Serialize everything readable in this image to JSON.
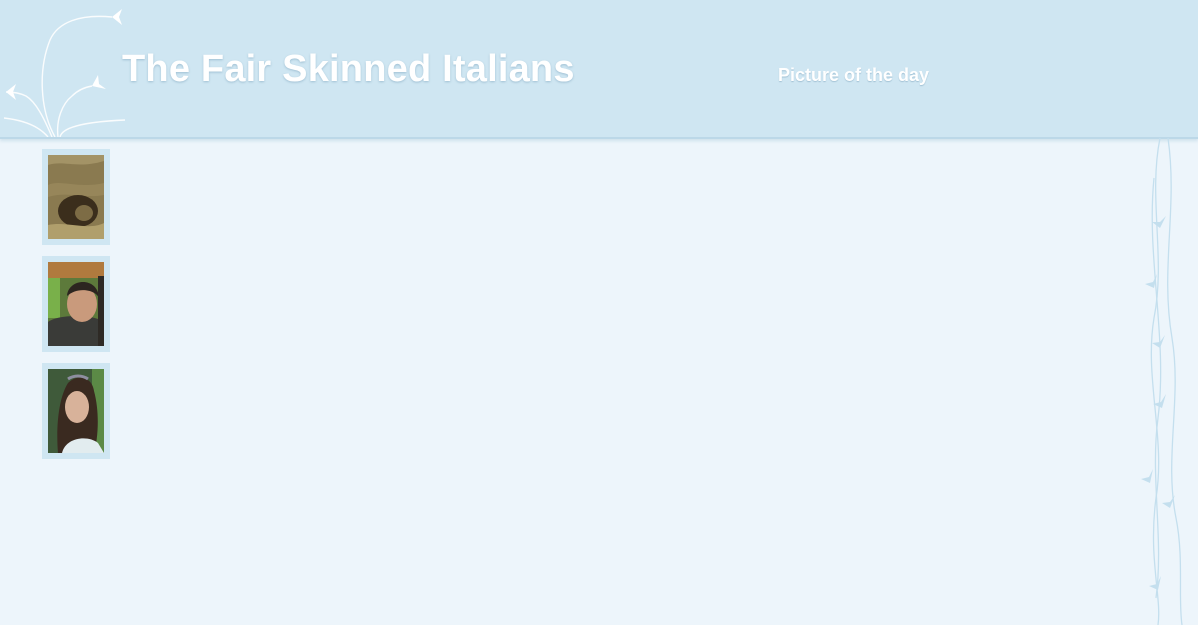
{
  "header": {
    "title": "The Fair Skinned Italians",
    "nav_link": "Picture of the day"
  },
  "thumbnails": [
    {
      "subject": "ultrasound scan"
    },
    {
      "subject": "smiling man"
    },
    {
      "subject": "young woman"
    }
  ],
  "colors": {
    "page_background": "#edf5fb",
    "header_background": "#cfe6f2",
    "title_text": "#ffffff",
    "ornament": "#ffffff",
    "vine": "#c4dfee"
  }
}
